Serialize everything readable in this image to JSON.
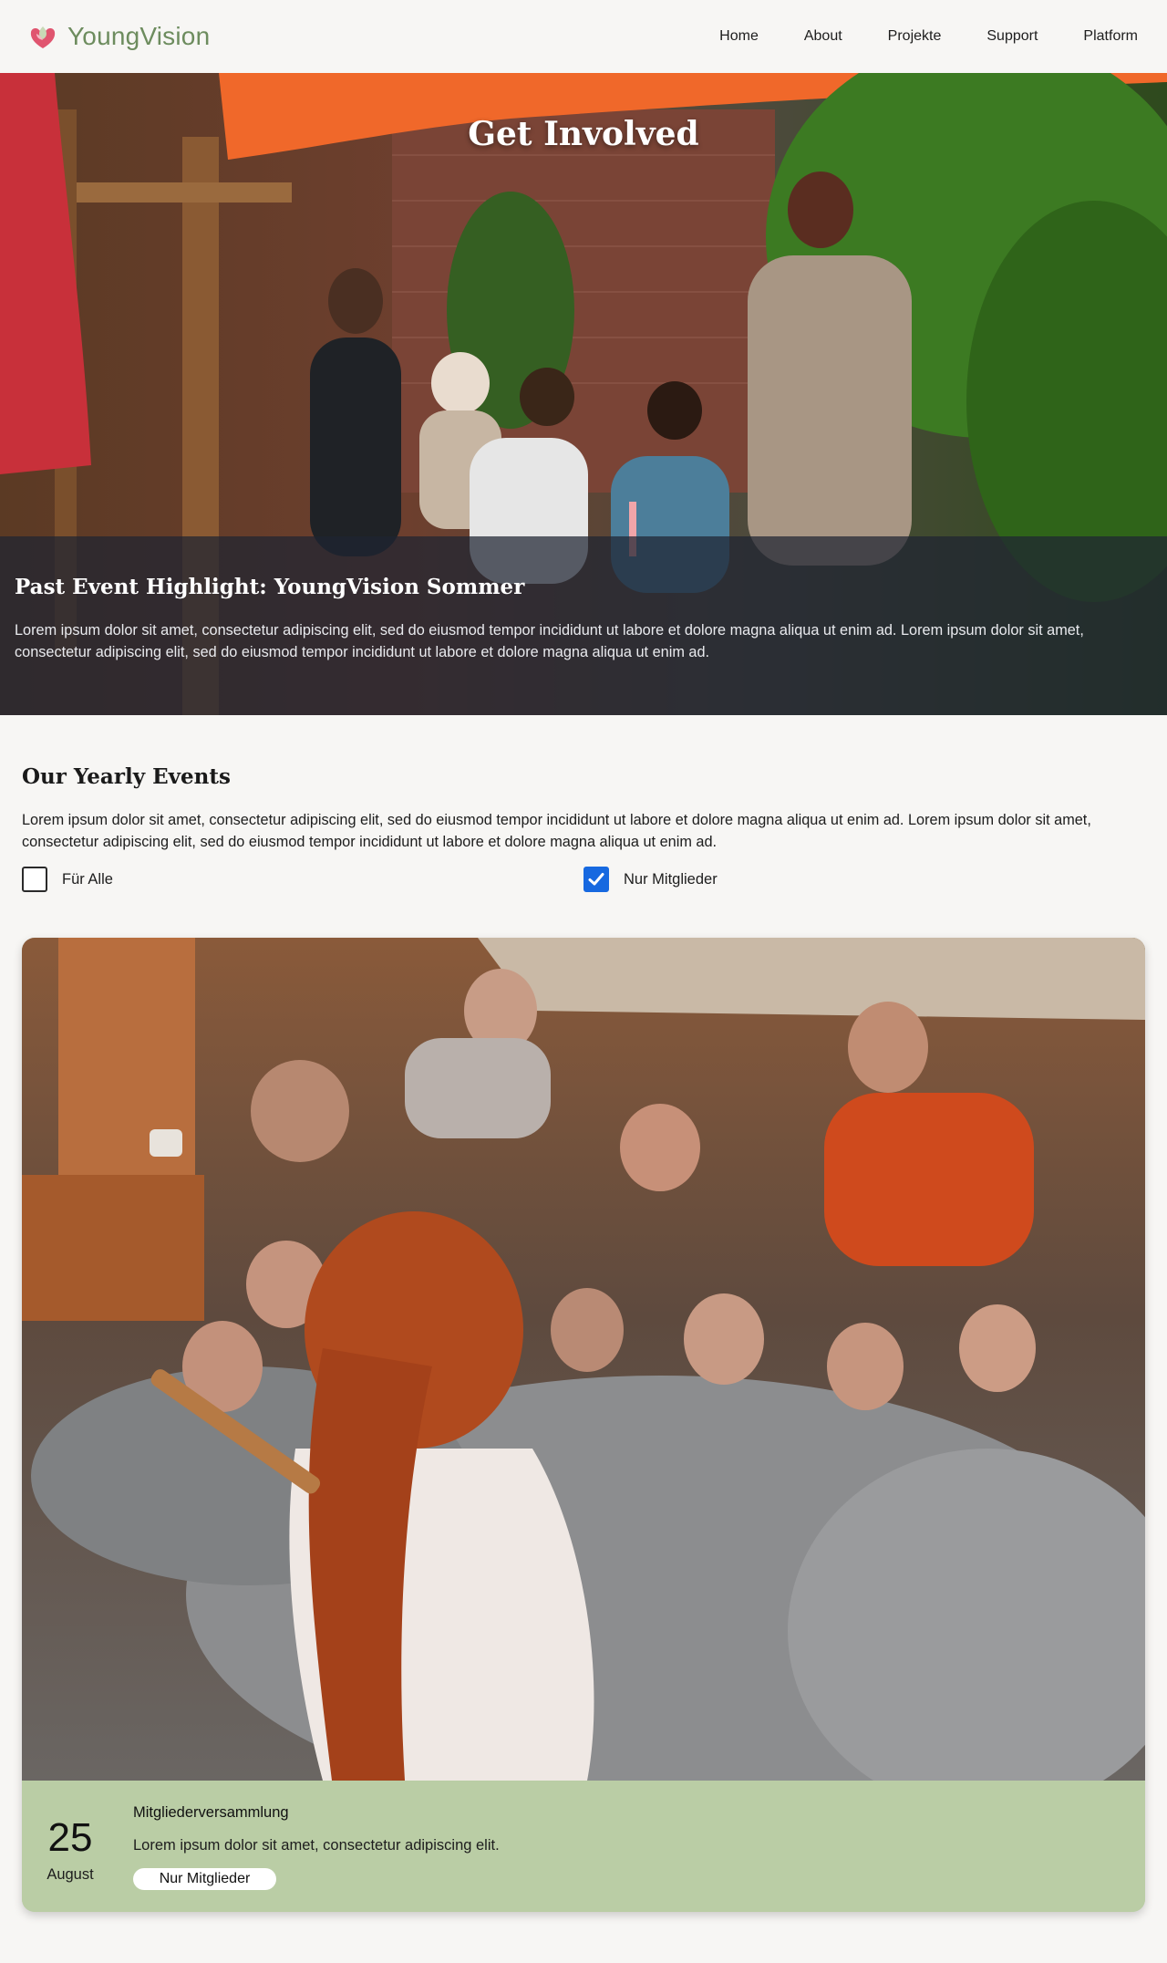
{
  "header": {
    "brand": "YoungVision",
    "logo_icon": "heart-leaf-logo-icon",
    "nav": [
      "Home",
      "About",
      "Projekte",
      "Support",
      "Platform"
    ]
  },
  "hero": {
    "title": "Get Involved",
    "panel_title": "Past Event Highlight: YoungVision Sommer",
    "panel_text": "Lorem ipsum dolor sit amet, consectetur adipiscing elit, sed do eiusmod tempor incididunt ut labore et dolore magna aliqua ut enim ad. Lorem ipsum dolor sit amet, consectetur adipiscing elit, sed do eiusmod tempor incididunt ut labore et dolore magna aliqua ut enim ad."
  },
  "events": {
    "title": "Our Yearly Events",
    "text": "Lorem ipsum dolor sit amet, consectetur adipiscing elit, sed do eiusmod tempor incididunt ut labore et dolore magna aliqua ut enim ad. Lorem ipsum dolor sit amet, consectetur adipiscing elit, sed do eiusmod tempor incididunt ut labore et dolore magna aliqua ut enim ad.",
    "filters": [
      {
        "label": "Für Alle",
        "checked": false
      },
      {
        "label": "Nur Mitglieder",
        "checked": true
      }
    ]
  },
  "card": {
    "day": "25",
    "month": "August",
    "title": "Mitgliederversammlung",
    "description": "Lorem ipsum dolor sit amet, consectetur adipiscing elit.",
    "badge": "Nur Mitglieder"
  },
  "colors": {
    "brand_green": "#6d8c5e",
    "logo_pink": "#e0556f",
    "card_green": "#bacda5",
    "checkbox_blue": "#1769e0"
  }
}
